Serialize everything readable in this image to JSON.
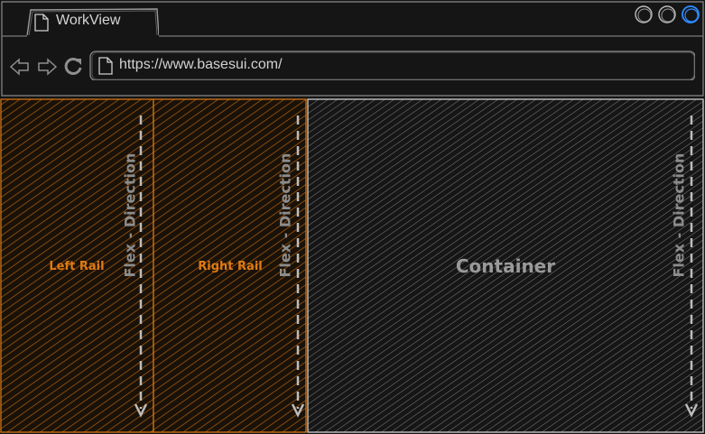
{
  "browser": {
    "tab_title": "WorkView",
    "url": "https://www.basesui.com/"
  },
  "diagram": {
    "left_rail": {
      "label": "Left Rail",
      "flex_label": "Flex - Direction"
    },
    "right_rail": {
      "label": "Right Rail",
      "flex_label": "Flex - Direction"
    },
    "container": {
      "label": "Container",
      "flex_label": "Flex - Direction"
    }
  },
  "colors": {
    "background": "#151515",
    "rail_accent": "#e07a12",
    "container_stroke": "#bdbdbd",
    "window_highlight": "#2f8cff"
  },
  "icons": [
    "page-icon",
    "back-arrow-icon",
    "forward-arrow-icon",
    "refresh-icon",
    "minimize-icon",
    "maximize-icon",
    "close-icon"
  ]
}
